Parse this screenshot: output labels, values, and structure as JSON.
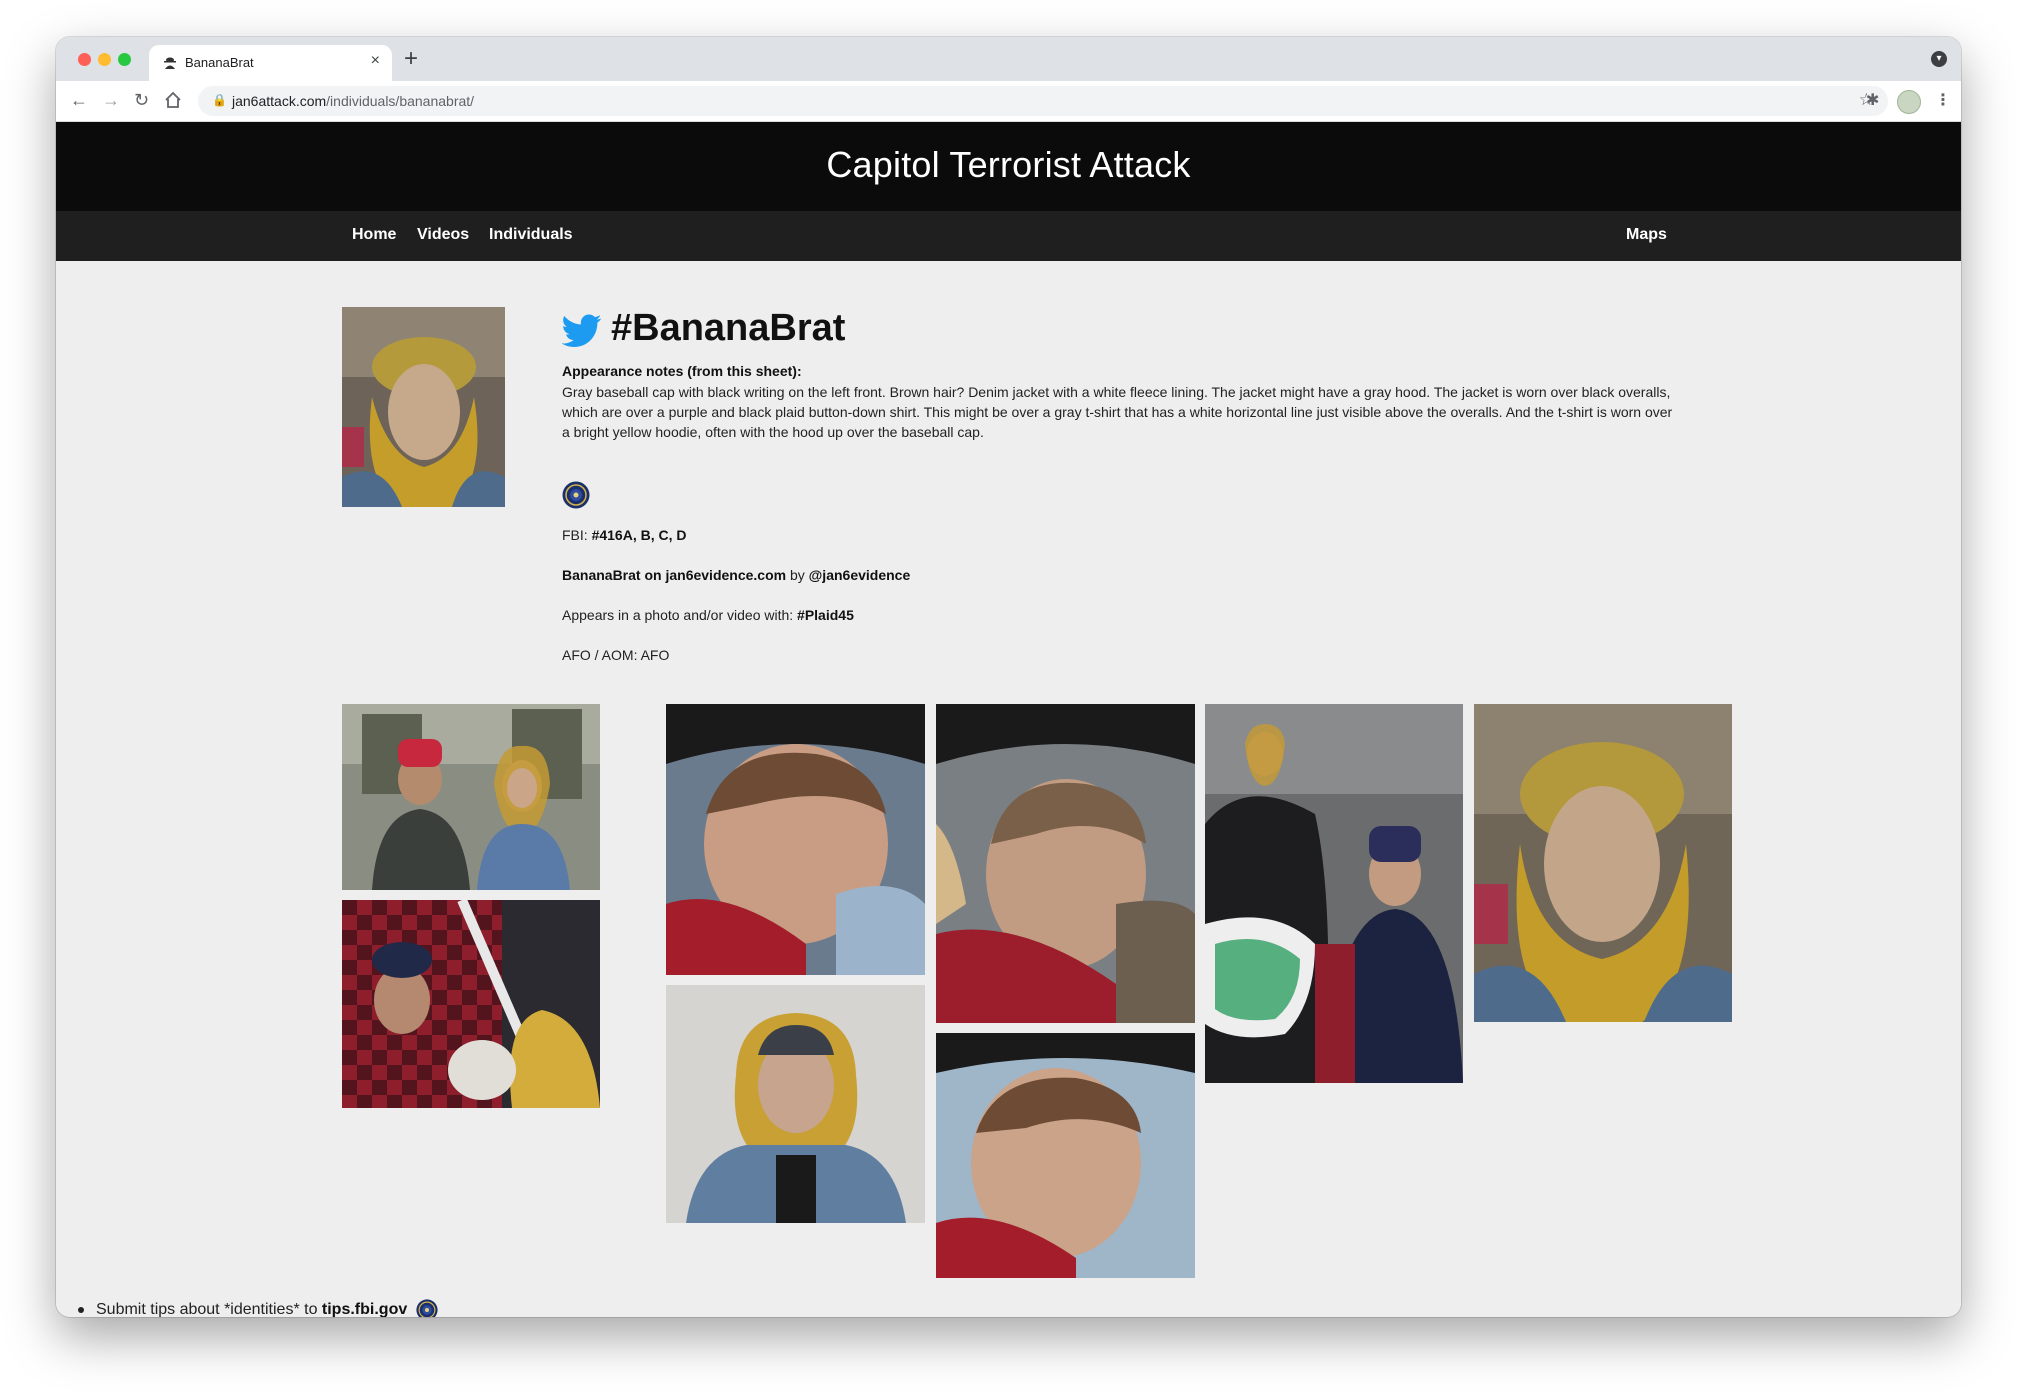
{
  "browser": {
    "tab_title": "BananaBrat",
    "tab_close": "×",
    "new_tab": "+",
    "url_domain": "jan6attack.com",
    "url_path": "/individuals/bananabrat/"
  },
  "site": {
    "title": "Capitol Terrorist Attack",
    "nav": {
      "home": "Home",
      "videos": "Videos",
      "individuals": "Individuals",
      "maps": "Maps"
    }
  },
  "individual": {
    "handle": "#BananaBrat",
    "notes_label": "Appearance notes (from this sheet):",
    "notes_text": "Gray baseball cap with black writing on the left front. Brown hair? Denim jacket with a white fleece lining. The jacket might have a gray hood. The jacket is worn over black overalls, which are over a purple and black plaid button-down shirt. This might be over a gray t-shirt that has a white horizontal line just visible above the overalls. And the t-shirt is worn over a bright yellow hoodie, often with the hood up over the baseball cap.",
    "fbi_prefix": "FBI: ",
    "fbi_ids": "#416A, B, C, D",
    "evidence_link": "BananaBrat on jan6evidence.com",
    "evidence_by": " by ",
    "evidence_author": "@jan6evidence",
    "appears_prefix": "Appears in a photo and/or video with: ",
    "appears_with": "#Plaid45",
    "afo": "AFO / AOM: AFO"
  },
  "footer": {
    "tips_prefix": "Submit tips about *identities* to ",
    "tips_link": "tips.fbi.gov"
  },
  "colors": {
    "header_bg": "#0b0b0b",
    "nav_bg": "#1f1f1f",
    "page_bg": "#eeeeee",
    "twitter_blue": "#1d9bf0"
  }
}
